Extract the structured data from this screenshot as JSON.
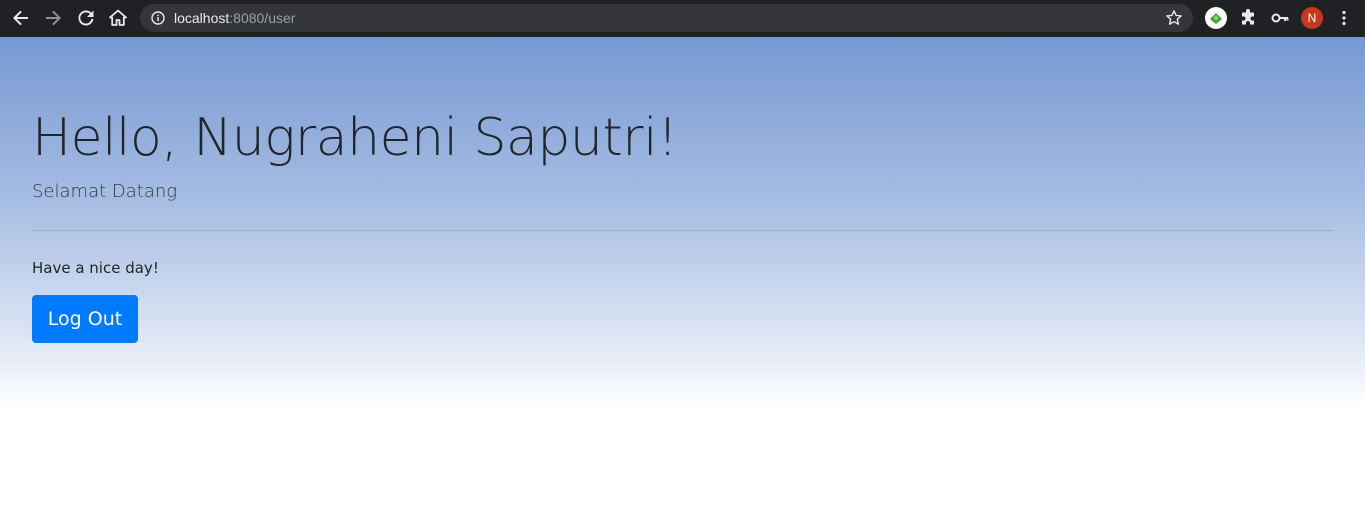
{
  "browser": {
    "url_host": "localhost",
    "url_rest": ":8080/user",
    "profile_initial": "N",
    "icons": {
      "back": "back-arrow-icon",
      "forward": "forward-arrow-icon",
      "reload": "reload-icon",
      "home": "home-icon",
      "info": "info-icon",
      "bookmark": "star-icon",
      "extension": "green-extension-icon",
      "extensions_menu": "puzzle-icon",
      "passwords": "key-icon",
      "menu": "kebab-menu-icon"
    }
  },
  "page": {
    "title": "Hello, Nugraheni Saputri!",
    "subtitle": "Selamat Datang",
    "message": "Have a nice day!",
    "logout_label": "Log Out"
  },
  "colors": {
    "toolbar_bg": "#202124",
    "gradient_top": "#7698d2",
    "button_primary": "#007bff",
    "avatar": "#c5391c"
  }
}
